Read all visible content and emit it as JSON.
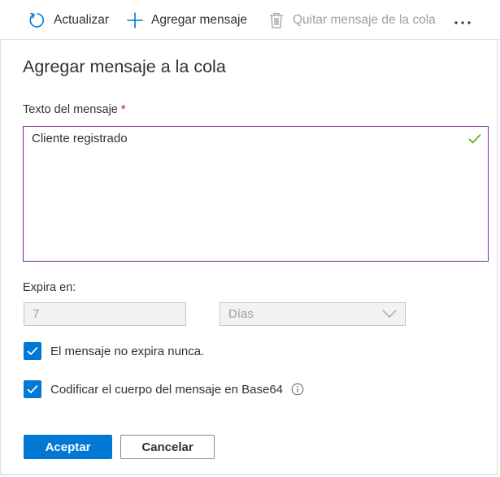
{
  "toolbar": {
    "refresh_label": "Actualizar",
    "add_label": "Agregar mensaje",
    "remove_label": "Quitar mensaje de la cola",
    "more_label": "···"
  },
  "panel": {
    "title": "Agregar mensaje a la cola",
    "message_label": "Texto del mensaje",
    "required_mark": "*",
    "message_value": "Cliente registrado",
    "expires_label": "Expira en:",
    "expires_value": "7",
    "expires_unit": "Días",
    "never_expires_label": "El mensaje no expira nunca.",
    "never_expires_checked": true,
    "base64_label": "Codificar el cuerpo del mensaje en Base64",
    "base64_checked": true,
    "ok_label": "Aceptar",
    "cancel_label": "Cancelar"
  },
  "colors": {
    "accent": "#0078d4",
    "focus_border": "#7a2e8e",
    "valid_check": "#57a300",
    "required": "#a4262c",
    "disabled_text": "#a19f9d"
  },
  "icons": [
    "refresh-icon",
    "plus-icon",
    "trash-icon",
    "more-icon",
    "valid-check-icon",
    "chevron-down-icon",
    "checkmark-icon",
    "info-icon"
  ]
}
